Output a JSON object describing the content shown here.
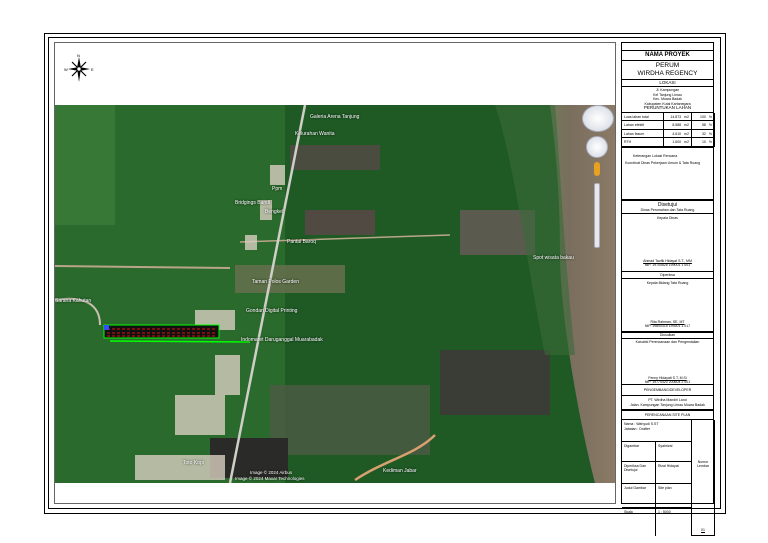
{
  "compass": {
    "north": "N",
    "west": "W",
    "east": "E"
  },
  "map": {
    "labels": [
      "Galeria Arena Tanjung",
      "Kelurahan Wanita",
      "Bridgings Bandi",
      "Ppm",
      "Bengkel",
      "Pantai Baroq",
      "Spot wisata bakau",
      "Taman Polos Garden",
      "Gondan Digital Printing",
      "Indomaret Daruganggal Muarabadak",
      "Sarana Kahutan",
      "Toto Kopi",
      "Kediman Jabar"
    ],
    "attribution": [
      "Image © 2024 Airbus",
      "Image © 2024 Maxar Technologies"
    ]
  },
  "title_block": {
    "project_header": "NAMA PROYEK",
    "project_name_1": "PERUM",
    "project_name_2": "WIRDHA REGENCY",
    "location_header": "LOKASI",
    "address": [
      "Jl. Kampungan",
      "Kel Tanjung Limau",
      "Kec. Muara Badak",
      "Kabupaten Kutai Kartanegara"
    ],
    "land_use_header": "PERUNTUKAN LAHAN",
    "land_use": [
      {
        "label": "Luas lahan total",
        "area": "14.873",
        "unit": "m2",
        "pct": "100",
        "pu": "%"
      },
      {
        "label": "Lahan efektif",
        "area": "8.588",
        "unit": "m2",
        "pct": "58",
        "pu": "%"
      },
      {
        "label": "Lahan fasum",
        "area": "4.610",
        "unit": "m2",
        "pct": "32",
        "pu": "%"
      },
      {
        "label": "RTH",
        "area": "1.600",
        "unit": "m2",
        "pct": "10",
        "pu": "%"
      }
    ],
    "notes": [
      "Keterangan Lokasi Rencana",
      "Koordinat   Dinas Pekerjaan Umum & Tata Ruang"
    ],
    "approved_header": "Disetujui",
    "approved_by": "Dinas Perumahan dan Tata Ruang",
    "approved_role": "Kepala Dinas",
    "sig1_name": "Ahmad Taufik Hidayat S.T., MM",
    "sig1_nip": "NIP. 19700825 199001 1 001",
    "checked_header": "Diperiksa",
    "checked_role": "Kepala Bidang Tata Ruang",
    "sig2_name": "Rita Rahman, SE, MT",
    "sig2_nip": "NIP. 19800315 199301 1 017",
    "proposed_header": "Diusulkan",
    "proposed_role": "Kasubid Perencanaan dan Pengendalian",
    "sig3_name": "Fenny Hidayati S.T, M.Si",
    "sig3_nip": "NIP. 19770420 200604 2 001",
    "developer_header": "PENGEMBANG/DEVELOPER",
    "developer_name": "PT. Wirdha Mandiri Land",
    "developer_addr": "Jalan. Kampungan Tanjung Limau Muara Badak",
    "drawing_header": "PERENCANAAN SITE PLAN",
    "name_label": "Nama : Wahyudi S.ST",
    "id_label": "Jabatan : Drafter",
    "cells": [
      "Digambar",
      "Syahrizal",
      "Diperiksa Dan Disetujui",
      "Rizal Hidayat",
      "Judul Gambar",
      "Site plan",
      "Skala",
      "1 : 5000"
    ],
    "sheet_label": "Nomor Lembar",
    "sheet_value": "01"
  }
}
